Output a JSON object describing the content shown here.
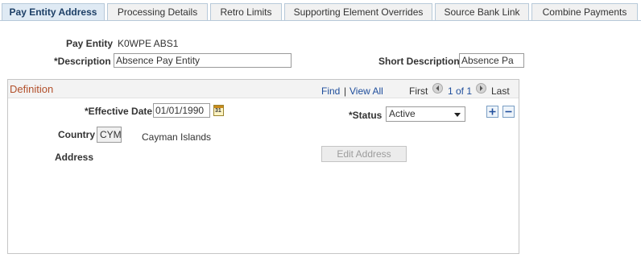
{
  "tabs": [
    {
      "label": "Pay Entity Address",
      "active": true
    },
    {
      "label": "Processing Details",
      "active": false
    },
    {
      "label": "Retro Limits",
      "active": false
    },
    {
      "label": "Supporting Element Overrides",
      "active": false
    },
    {
      "label": "Source Bank Link",
      "active": false
    },
    {
      "label": "Combine Payments",
      "active": false
    }
  ],
  "header": {
    "pay_entity_label": "Pay Entity",
    "pay_entity_value": "K0WPE ABS1",
    "description_label": "*Description",
    "description_value": "Absence Pay Entity",
    "short_description_label": "Short Description",
    "short_description_value": "Absence Pa"
  },
  "definition": {
    "title": "Definition",
    "find": "Find",
    "separator": "|",
    "view_all": "View All",
    "first": "First",
    "counter": "1 of 1",
    "last": "Last",
    "effective_date_label": "*Effective Date",
    "effective_date_value": "01/01/1990",
    "calendar_day": "31",
    "status_label": "*Status",
    "status_value": "Active",
    "country_label": "Country",
    "country_code": "CYM",
    "country_name": "Cayman Islands",
    "address_label": "Address",
    "edit_address_button": "Edit Address"
  },
  "colors": {
    "tab_active_bg": "#dfeaf4",
    "group_title": "#b2502b",
    "link": "#1f4e9c"
  }
}
